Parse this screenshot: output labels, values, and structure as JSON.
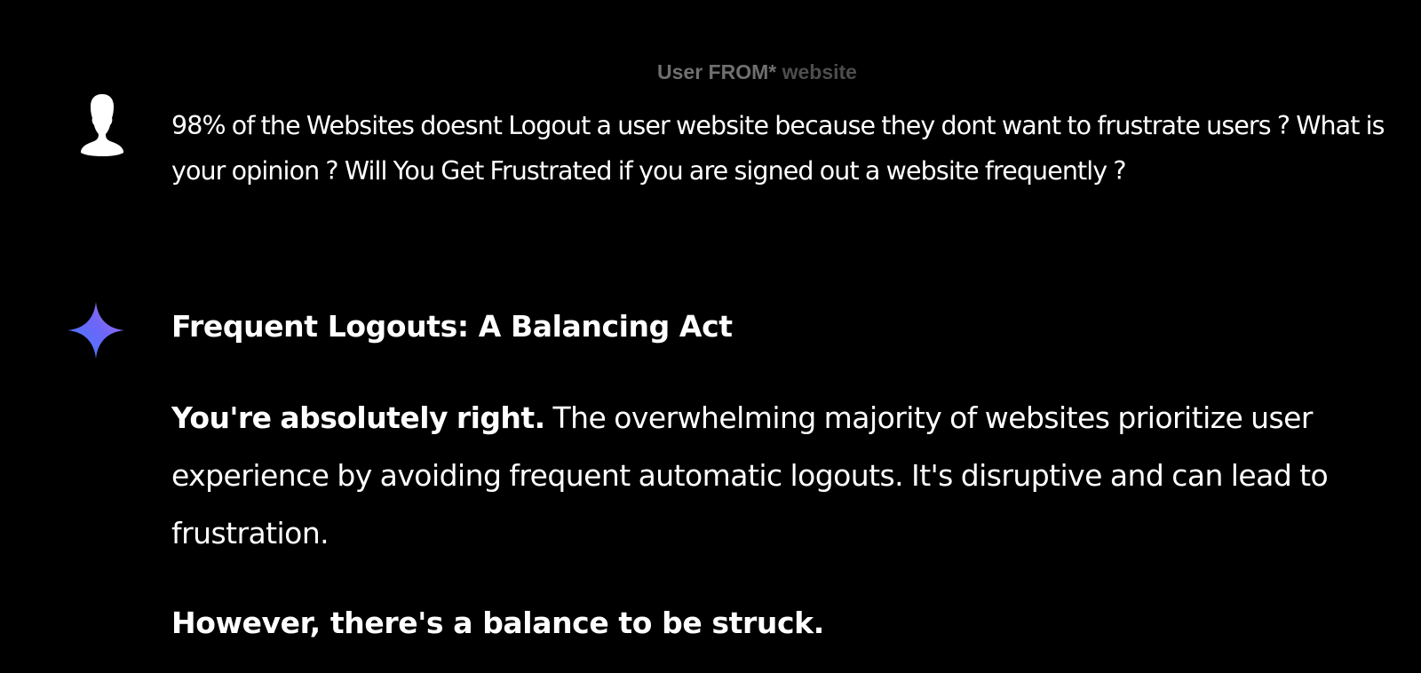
{
  "header": {
    "label_part1": "User FROM*",
    "label_part2": "website"
  },
  "user_message": {
    "text": "98% of the Websites doesnt Logout a user website because they dont want to frustrate users ? What is your opinion ? Will You Get Frustrated if you are signed out a website frequently ?",
    "avatar_icon": "user-silhouette-icon"
  },
  "response": {
    "icon": "gemini-sparkle-icon",
    "heading": "Frequent Logouts: A Balancing Act",
    "paragraph_bold": "You're absolutely right.",
    "paragraph_rest": "The overwhelming majority of websites prioritize user experience by avoiding frequent automatic logouts. It's disruptive and can lead to frustration.",
    "subheading": "However, there's a balance to be struck."
  },
  "colors": {
    "background": "#000000",
    "text": "#ffffff",
    "label": "#6f6f6f",
    "label_dim": "#4d4d4d",
    "sparkle_gradient": [
      "#4f8bff",
      "#7a5cf5",
      "#b36ee8"
    ]
  }
}
